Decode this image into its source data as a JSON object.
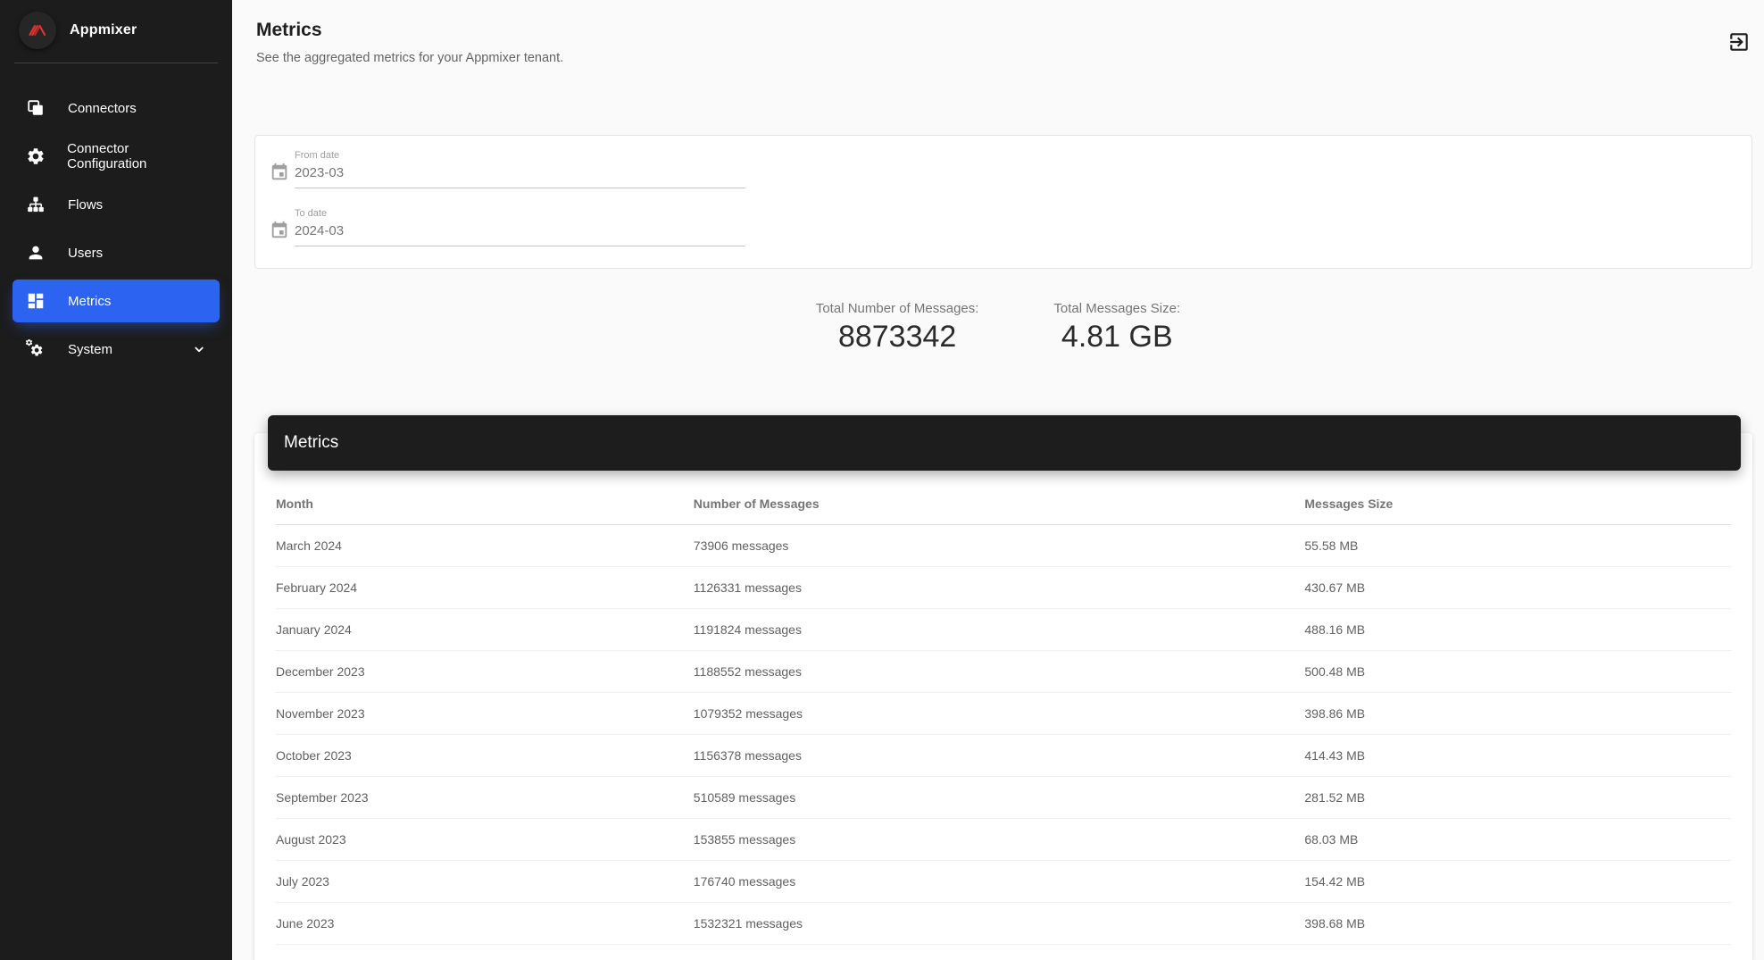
{
  "app": {
    "name": "Appmixer"
  },
  "sidebar": {
    "items": [
      {
        "label": "Connectors"
      },
      {
        "label": "Connector Configuration"
      },
      {
        "label": "Flows"
      },
      {
        "label": "Users"
      },
      {
        "label": "Metrics",
        "active": true
      },
      {
        "label": "System",
        "expandable": true
      }
    ]
  },
  "header": {
    "title": "Metrics",
    "subtitle": "See the aggregated metrics for your Appmixer tenant."
  },
  "filters": {
    "from": {
      "label": "From date",
      "value": "2023-03"
    },
    "to": {
      "label": "To date",
      "value": "2024-03"
    }
  },
  "totals": {
    "messages": {
      "label": "Total Number of Messages:",
      "value": "8873342"
    },
    "size": {
      "label": "Total Messages Size:",
      "value": "4.81 GB"
    }
  },
  "table": {
    "toolbar_title": "Metrics",
    "columns": [
      "Month",
      "Number of Messages",
      "Messages Size"
    ],
    "rows": [
      [
        "March 2024",
        "73906 messages",
        "55.58 MB"
      ],
      [
        "February 2024",
        "1126331 messages",
        "430.67 MB"
      ],
      [
        "January 2024",
        "1191824 messages",
        "488.16 MB"
      ],
      [
        "December 2023",
        "1188552 messages",
        "500.48 MB"
      ],
      [
        "November 2023",
        "1079352 messages",
        "398.86 MB"
      ],
      [
        "October 2023",
        "1156378 messages",
        "414.43 MB"
      ],
      [
        "September 2023",
        "510589 messages",
        "281.52 MB"
      ],
      [
        "August 2023",
        "153855 messages",
        "68.03 MB"
      ],
      [
        "July 2023",
        "176740 messages",
        "154.42 MB"
      ],
      [
        "June 2023",
        "1532321 messages",
        "398.68 MB"
      ]
    ]
  },
  "icons": {
    "logo": "appmixer-logo",
    "logout": "logout-icon",
    "calendar": "calendar-icon"
  },
  "colors": {
    "accent": "#2c63f0",
    "sidebar_bg": "#1c1c1c",
    "toolbar_bg": "#1d1d1d",
    "logo_red": "#e23230",
    "page_bg": "#fafafa"
  }
}
